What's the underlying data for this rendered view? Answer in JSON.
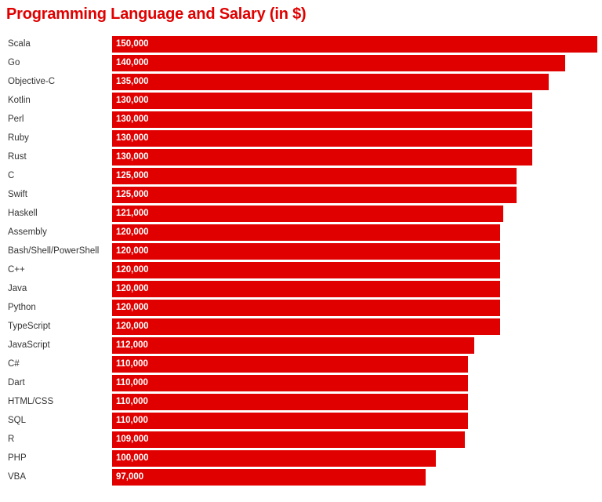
{
  "chart": {
    "title": "Programming Language and Salary (in $)",
    "accent_color": "#e00000",
    "label_color": "#333333",
    "value_color": "#ffffff",
    "background_color": "#ffffff"
  },
  "chart_data": {
    "type": "bar",
    "orientation": "horizontal",
    "title": "Programming Language and Salary (in $)",
    "xlabel": "",
    "ylabel": "",
    "xlim": [
      0,
      150000
    ],
    "grid": false,
    "legend": null,
    "value_labels_inside_bars": true,
    "categories": [
      "Scala",
      "Go",
      "Objective-C",
      "Kotlin",
      "Perl",
      "Ruby",
      "Rust",
      "C",
      "Swift",
      "Haskell",
      "Assembly",
      "Bash/Shell/PowerShell",
      "C++",
      "Java",
      "Python",
      "TypeScript",
      "JavaScript",
      "C#",
      "Dart",
      "HTML/CSS",
      "SQL",
      "R",
      "PHP",
      "VBA"
    ],
    "values": [
      150000,
      140000,
      135000,
      130000,
      130000,
      130000,
      130000,
      125000,
      125000,
      121000,
      120000,
      120000,
      120000,
      120000,
      120000,
      120000,
      112000,
      110000,
      110000,
      110000,
      110000,
      109000,
      100000,
      97000
    ],
    "value_labels": [
      "150,000",
      "140,000",
      "135,000",
      "130,000",
      "130,000",
      "130,000",
      "130,000",
      "125,000",
      "125,000",
      "121,000",
      "120,000",
      "120,000",
      "120,000",
      "120,000",
      "120,000",
      "120,000",
      "112,000",
      "110,000",
      "110,000",
      "110,000",
      "110,000",
      "109,000",
      "100,000",
      "97,000"
    ]
  }
}
